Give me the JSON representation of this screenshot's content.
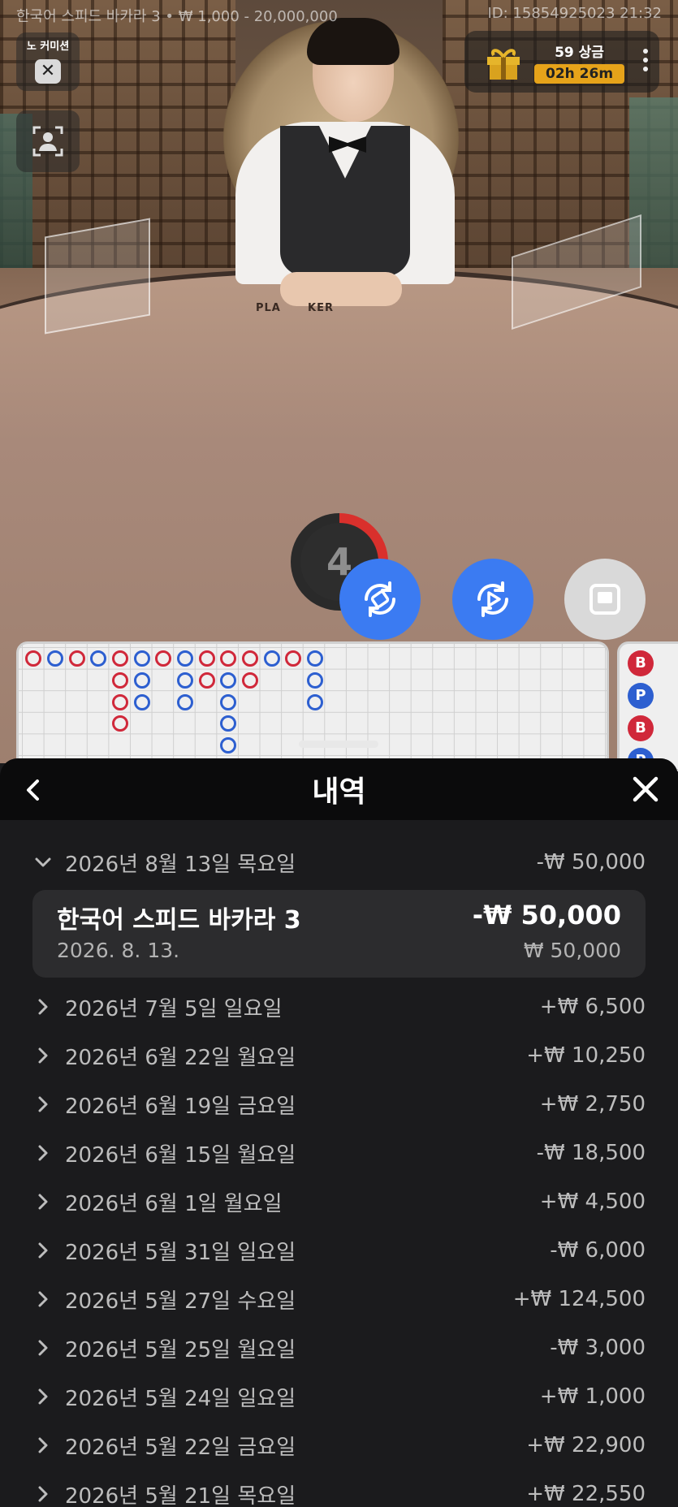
{
  "table_info": {
    "left": "한국어 스피드 바카라 3 • ₩ 1,000 - 20,000,000",
    "right": "ID: 15854925023 21:32"
  },
  "table_label": "PLA      KER",
  "no_commission": {
    "label": "노 커미션",
    "toggle": "✕"
  },
  "prize": {
    "title": "59 상금",
    "timer": "02h 26m"
  },
  "countdown": "4",
  "sheet": {
    "title": "내역",
    "expanded_day": {
      "date": "2026년 8월 13일 목요일",
      "amount": "-₩ 50,000",
      "game": {
        "name": "한국어 스피드 바카라 3",
        "net": "-₩ 50,000",
        "date": "2026. 8. 13.",
        "stake": "₩ 50,000"
      }
    },
    "days": [
      {
        "date": "2026년 7월 5일 일요일",
        "amount": "+₩ 6,500"
      },
      {
        "date": "2026년 6월 22일 월요일",
        "amount": "+₩ 10,250"
      },
      {
        "date": "2026년 6월 19일 금요일",
        "amount": "+₩ 2,750"
      },
      {
        "date": "2026년 6월 15일 월요일",
        "amount": "-₩ 18,500"
      },
      {
        "date": "2026년 6월 1일 월요일",
        "amount": "+₩ 4,500"
      },
      {
        "date": "2026년 5월 31일 일요일",
        "amount": "-₩ 6,000"
      },
      {
        "date": "2026년 5월 27일 수요일",
        "amount": "+₩ 124,500"
      },
      {
        "date": "2026년 5월 25일 월요일",
        "amount": "-₩ 3,000"
      },
      {
        "date": "2026년 5월 24일 일요일",
        "amount": "+₩ 1,000"
      },
      {
        "date": "2026년 5월 22일 금요일",
        "amount": "+₩ 22,900"
      },
      {
        "date": "2026년 5월 21일 목요일",
        "amount": "+₩ 22,550"
      }
    ]
  },
  "beads": [
    "B",
    "P",
    "B",
    "P"
  ],
  "colors": {
    "banker": "#d0283a",
    "player": "#2d5fd0",
    "fab_blue": "#3b7bf2",
    "timer": "#e6a31a"
  }
}
